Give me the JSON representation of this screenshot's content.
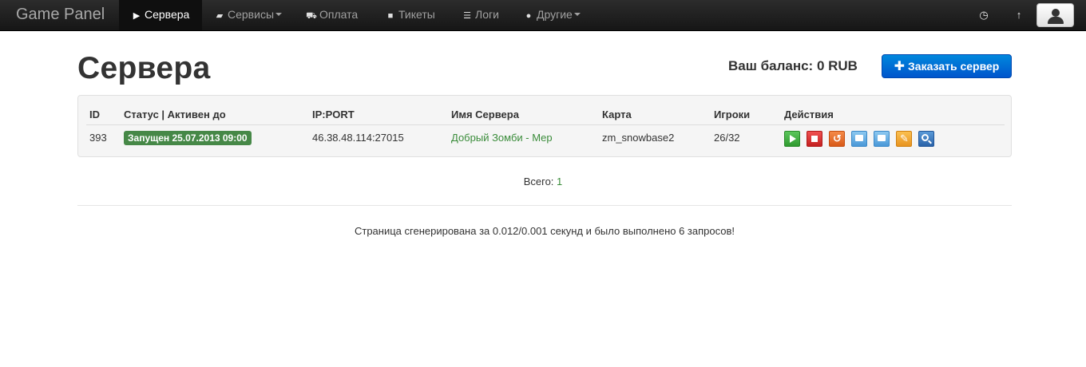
{
  "navbar": {
    "brand": "Game Panel",
    "items": [
      {
        "label": "Сервера",
        "icon": "play-icon",
        "active": true
      },
      {
        "label": "Сервисы",
        "icon": "briefcase-icon",
        "dropdown": true
      },
      {
        "label": "Оплата",
        "icon": "cart-icon"
      },
      {
        "label": "Тикеты",
        "icon": "chat-icon"
      },
      {
        "label": "Логи",
        "icon": "list-icon"
      },
      {
        "label": "Другие",
        "icon": "info-icon",
        "dropdown": true
      }
    ],
    "right_icons": [
      "clock-icon",
      "arrow-up-icon",
      "user-icon"
    ]
  },
  "header": {
    "title": "Сервера",
    "balance": "Ваш баланс: 0 RUB",
    "order_button": "Заказать сервер"
  },
  "table": {
    "columns": [
      "ID",
      "Статус | Активен до",
      "IP:PORT",
      "Имя Сервера",
      "Карта",
      "Игроки",
      "Действия"
    ],
    "rows": [
      {
        "id": "393",
        "status": "Запущен 25.07.2013 09:00",
        "ip_port": "46.38.48.114:27015",
        "name": "Добрый Зомби - Мер",
        "map": "zm_snowbase2",
        "players": "26/32"
      }
    ],
    "actions": [
      {
        "icon": "start-icon",
        "color": "#3aa63a"
      },
      {
        "icon": "stop-icon",
        "color": "#d83030"
      },
      {
        "icon": "restart-icon",
        "color": "#e8702c"
      },
      {
        "icon": "console-icon",
        "color": "#58a8e0"
      },
      {
        "icon": "chat-icon",
        "color": "#58a8e0"
      },
      {
        "icon": "edit-icon",
        "color": "#f0a030"
      },
      {
        "icon": "search-icon",
        "color": "#3b78c0"
      }
    ]
  },
  "summary": {
    "total_label": "Всего:",
    "total_value": "1"
  },
  "footer": "Страница сгенерирована за 0.012/0.001 секунд и было выполнено 6 запросов!",
  "colors": {
    "navbar_bg": "#1b1b1b",
    "accent_blue": "#0066cc",
    "status_green": "#468847",
    "link_green": "#3a8c3a"
  }
}
